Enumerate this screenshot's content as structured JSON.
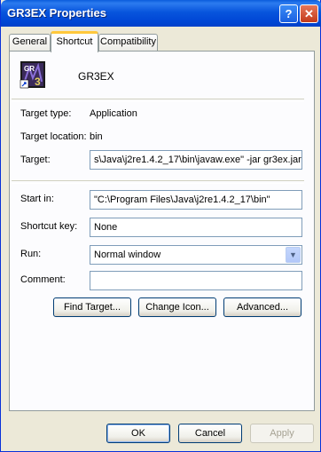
{
  "window": {
    "title": "GR3EX Properties",
    "help_glyph": "?",
    "close_glyph": "✕"
  },
  "tabs": [
    {
      "label": "General"
    },
    {
      "label": "Shortcut"
    },
    {
      "label": "Compatibility"
    }
  ],
  "shortcut": {
    "name": "GR3EX",
    "target_type_label": "Target type:",
    "target_type_value": "Application",
    "target_location_label": "Target location:",
    "target_location_value": "bin",
    "target_label": "Target:",
    "target_value": "s\\Java\\j2re1.4.2_17\\bin\\javaw.exe\" -jar gr3ex.jar",
    "start_in_label": "Start in:",
    "start_in_value": "\"C:\\Program Files\\Java\\j2re1.4.2_17\\bin\"",
    "shortcut_key_label": "Shortcut key:",
    "shortcut_key_value": "None",
    "run_label": "Run:",
    "run_value": "Normal window",
    "comment_label": "Comment:",
    "comment_value": ""
  },
  "buttons": {
    "find_target": "Find Target...",
    "change_icon": "Change Icon...",
    "advanced": "Advanced...",
    "ok": "OK",
    "cancel": "Cancel",
    "apply": "Apply"
  },
  "icons": {
    "app": "gr3ex-app-icon",
    "help": "help-icon",
    "close": "close-icon",
    "dropdown": "chevron-down-icon"
  }
}
